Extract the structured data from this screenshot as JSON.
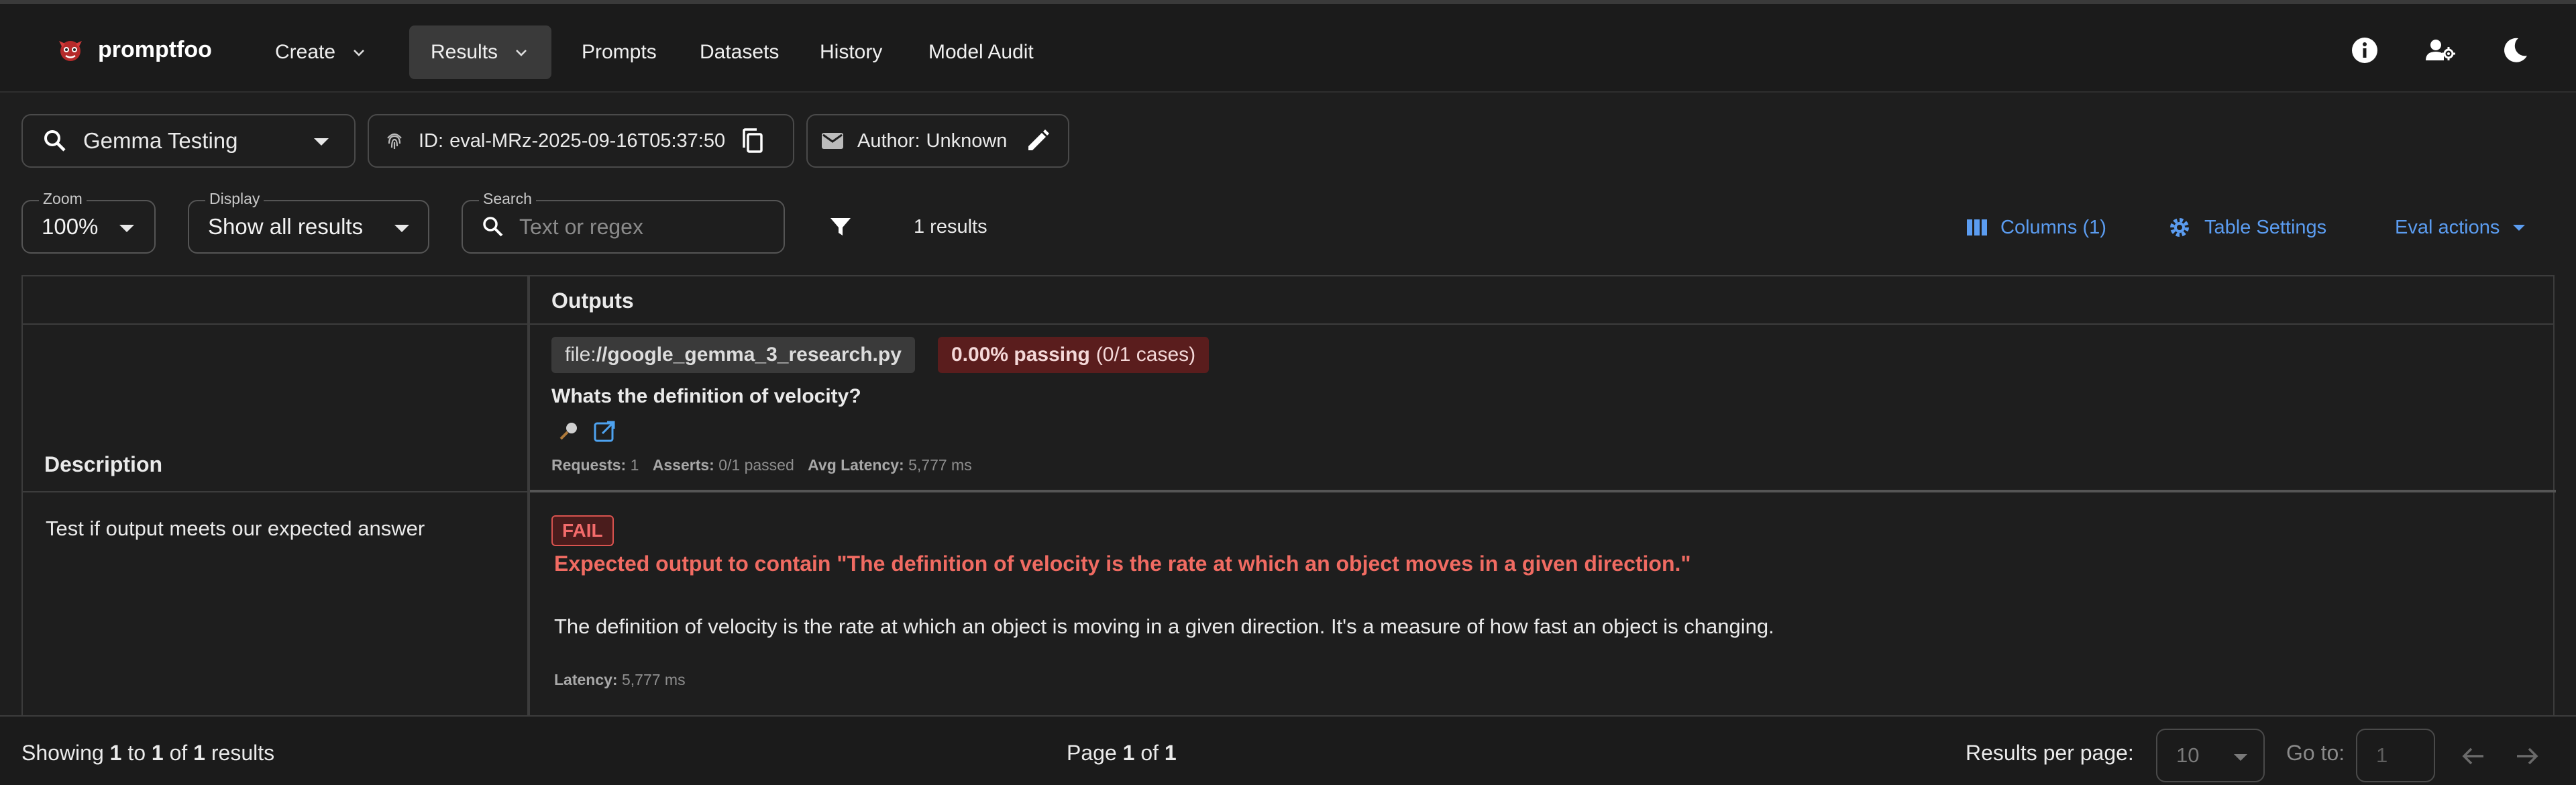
{
  "app": {
    "name": "promptfoo"
  },
  "nav": {
    "create": "Create",
    "results": "Results",
    "prompts": "Prompts",
    "datasets": "Datasets",
    "history": "History",
    "model_audit": "Model Audit"
  },
  "eval": {
    "name": "Gemma Testing",
    "id_label": "ID:",
    "id_value": "eval-MRz-2025-09-16T05:37:50",
    "author_label": "Author:",
    "author_value": "Unknown"
  },
  "controls": {
    "zoom_legend": "Zoom",
    "zoom_value": "100%",
    "display_legend": "Display",
    "display_value": "Show all results",
    "search_legend": "Search",
    "search_placeholder": "Text or regex",
    "results_count": "1 results",
    "columns": "Columns (1)",
    "table_settings": "Table Settings",
    "eval_actions": "Eval actions"
  },
  "table": {
    "outputs_header": "Outputs",
    "description_header": "Description",
    "file_prefix": "file:",
    "file_name": "//google_gemma_3_research.py",
    "pass_rate": "0.00% passing",
    "pass_cases": "(0/1 cases)",
    "prompt": "Whats the definition of velocity?",
    "stats": {
      "requests_label": "Requests:",
      "requests_value": "1",
      "asserts_label": "Asserts:",
      "asserts_value": "0/1 passed",
      "latency_label": "Avg Latency:",
      "latency_value": "5,777 ms"
    },
    "rows": [
      {
        "description": "Test if output meets our expected answer",
        "status": "FAIL",
        "fail_reason": "Expected output to contain \"The definition of velocity is the rate at which an object moves in a given direction.\"",
        "output": "The definition of velocity is the rate at which an object is moving in a given direction. It's a measure of how fast an object is changing.",
        "latency_label": "Latency:",
        "latency_value": "5,777 ms"
      }
    ]
  },
  "footer": {
    "showing": "Showing",
    "from": "1",
    "to_word": "to",
    "to": "1",
    "of_word": "of",
    "total": "1",
    "results_word": "results",
    "page_word": "Page",
    "page": "1",
    "page_of": "of",
    "page_total": "1",
    "per_page_label": "Results per page:",
    "per_page_value": "10",
    "goto_label": "Go to:",
    "goto_placeholder": "1"
  },
  "colors": {
    "accent": "#5b9cf0",
    "fail": "#f06b62",
    "fail_bg": "#5a1d1d"
  }
}
